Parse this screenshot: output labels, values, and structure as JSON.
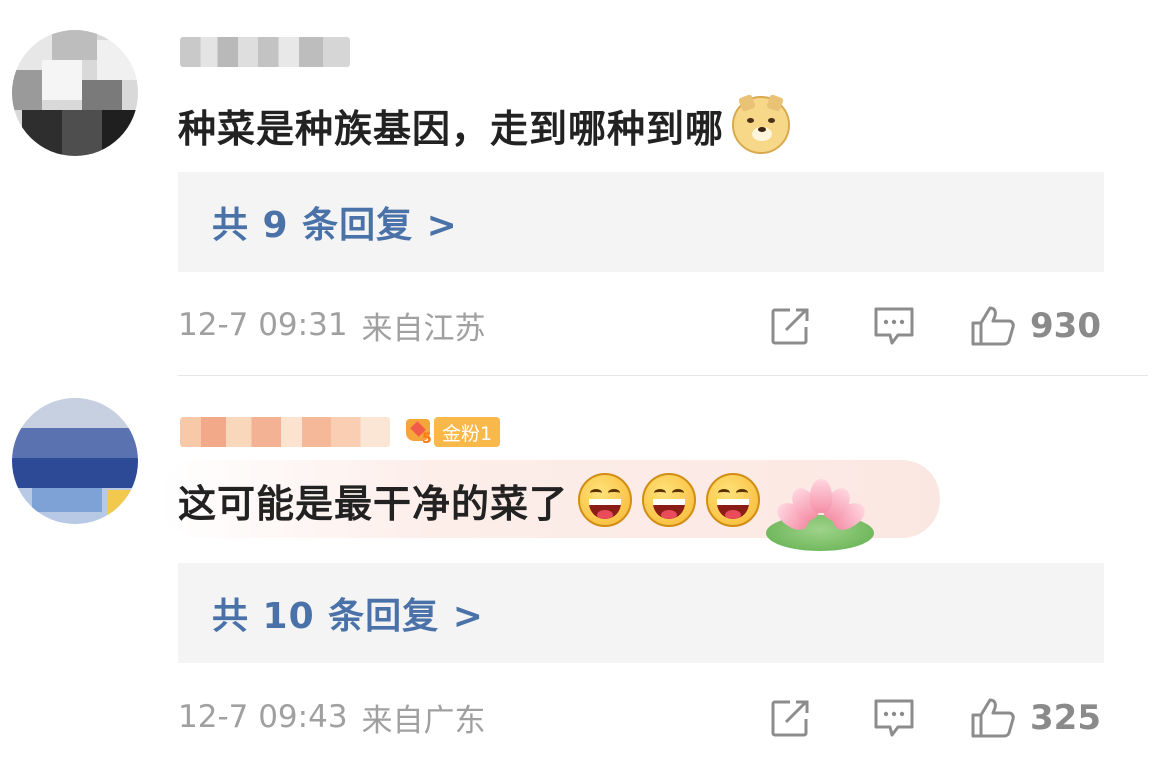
{
  "comments": [
    {
      "text": "种菜是种族基因，走到哪种到哪",
      "replies_label": "共 9 条回复 >",
      "time": "12-7 09:31",
      "from": "来自江苏",
      "likes": "930",
      "emojis": [
        "doge-emoji"
      ]
    },
    {
      "badge_label": "金粉1",
      "badge_level": "5",
      "text": "这可能是最干净的菜了",
      "replies_label": "共 10 条回复 >",
      "time": "12-7 09:43",
      "from": "来自广东",
      "likes": "325",
      "emojis": [
        "laughing-emoji",
        "laughing-emoji",
        "laughing-emoji"
      ],
      "decoration": "lotus-sticker"
    }
  ],
  "icons": {
    "share": "share-icon",
    "comment": "comment-icon",
    "like": "thumbs-up-icon"
  },
  "colors": {
    "reply_link": "#4a72a8",
    "meta_text": "#a0a0a0",
    "reply_bg": "#f4f4f4",
    "badge_bg": "#f8b84a"
  }
}
